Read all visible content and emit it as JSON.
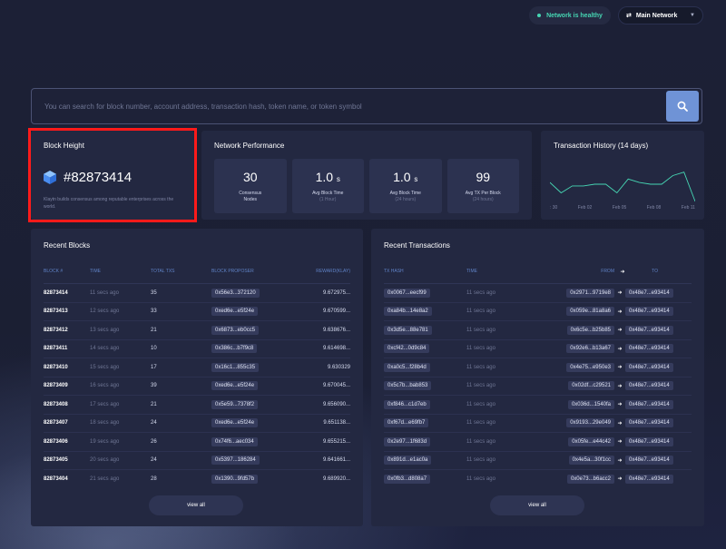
{
  "header": {
    "status": "Network is healthy",
    "network": "Main Network",
    "network_icon": "network-icon",
    "caret_icon": "chevron-down-icon",
    "accent": "#46d6b3"
  },
  "search": {
    "placeholder": "You can search for block number, account address, transaction hash, token name, or token symbol",
    "value": "",
    "icon": "search-icon",
    "button_color": "#6f93d6"
  },
  "block_height": {
    "title": "Block Height",
    "number": "#82873414",
    "description": "Klaytn builds consensus among reputable enterprises across the world.",
    "icon": "cube-icon"
  },
  "network_performance": {
    "title": "Network Performance",
    "stats": [
      {
        "value": "30",
        "unit": "",
        "label": "Consensus Nodes",
        "sub": ""
      },
      {
        "value": "1.0",
        "unit": "s",
        "label": "Avg Block Time",
        "sub": "(1 Hour)"
      },
      {
        "value": "1.0",
        "unit": "s",
        "label": "Avg Block Time",
        "sub": "(24 hours)"
      },
      {
        "value": "99",
        "unit": "",
        "label": "Avg TX Per Block",
        "sub": "(24 hours)"
      }
    ]
  },
  "tx_history": {
    "title": "Transaction History (14 days)",
    "axis": [
      ": 30",
      "Feb 02",
      "Feb 05",
      "Feb 08",
      "Feb 11"
    ],
    "series": [
      0.55,
      0.25,
      0.45,
      0.45,
      0.5,
      0.5,
      0.25,
      0.65,
      0.55,
      0.5,
      0.5,
      0.75,
      0.85,
      0.0
    ],
    "line_color": "#46d6b3"
  },
  "recent_blocks": {
    "title": "Recent Blocks",
    "columns": [
      "BLOCK #",
      "TIME",
      "TOTAL TXS",
      "BLOCK PROPOSER",
      "REWARD(KLAY)"
    ],
    "rows": [
      {
        "block": "82873414",
        "time": "11 secs ago",
        "txs": "35",
        "proposer": "0x56e3...372120",
        "reward": "9.672975..."
      },
      {
        "block": "82873413",
        "time": "12 secs ago",
        "txs": "33",
        "proposer": "0xed6e...e5f24e",
        "reward": "9.670599..."
      },
      {
        "block": "82873412",
        "time": "13 secs ago",
        "txs": "21",
        "proposer": "0x6873...eb0cc5",
        "reward": "9.638676..."
      },
      {
        "block": "82873411",
        "time": "14 secs ago",
        "txs": "10",
        "proposer": "0x386c...b7f9c8",
        "reward": "9.614698..."
      },
      {
        "block": "82873410",
        "time": "15 secs ago",
        "txs": "17",
        "proposer": "0x16c1...855c35",
        "reward": "9.630329"
      },
      {
        "block": "82873409",
        "time": "16 secs ago",
        "txs": "39",
        "proposer": "0xed6e...e5f24e",
        "reward": "9.670045..."
      },
      {
        "block": "82873408",
        "time": "17 secs ago",
        "txs": "21",
        "proposer": "0x5e59...7378f2",
        "reward": "9.656090..."
      },
      {
        "block": "82873407",
        "time": "18 secs ago",
        "txs": "24",
        "proposer": "0xed6e...e5f24e",
        "reward": "9.651138..."
      },
      {
        "block": "82873406",
        "time": "19 secs ago",
        "txs": "26",
        "proposer": "0x74f6...aec034",
        "reward": "9.655215..."
      },
      {
        "block": "82873405",
        "time": "20 secs ago",
        "txs": "24",
        "proposer": "0x5397...186284",
        "reward": "9.641661..."
      },
      {
        "block": "82873404",
        "time": "21 secs ago",
        "txs": "28",
        "proposer": "0x1390...9fd57b",
        "reward": "9.689920..."
      }
    ],
    "view_all": "view all"
  },
  "recent_transactions": {
    "title": "Recent Transactions",
    "columns": [
      "TX HASH",
      "TIME",
      "FROM",
      "➜",
      "TO"
    ],
    "rows": [
      {
        "hash": "0x0067...eecf99",
        "time": "11 secs ago",
        "from": "0x2971...9719e8",
        "to": "0x48e7...e93414"
      },
      {
        "hash": "0xa84b...14e8a2",
        "time": "11 secs ago",
        "from": "0x059e...81a8a6",
        "to": "0x48e7...e93414"
      },
      {
        "hash": "0x3d5e...88e781",
        "time": "11 secs ago",
        "from": "0x6c5e...b25b85",
        "to": "0x48e7...e93414"
      },
      {
        "hash": "0xcf42...0d9c84",
        "time": "11 secs ago",
        "from": "0x92e6...b13a67",
        "to": "0x48e7...e93414"
      },
      {
        "hash": "0xa0c5...f28b4d",
        "time": "11 secs ago",
        "from": "0x4e75...e950e3",
        "to": "0x48e7...e93414"
      },
      {
        "hash": "0x5c7b...bab853",
        "time": "11 secs ago",
        "from": "0x02df...c29521",
        "to": "0x48e7...e93414"
      },
      {
        "hash": "0xf846...c1d7eb",
        "time": "11 secs ago",
        "from": "0x036d...1540fa",
        "to": "0x48e7...e93414"
      },
      {
        "hash": "0xf67d...e69fb7",
        "time": "11 secs ago",
        "from": "0x9193...29e049",
        "to": "0x48e7...e93414"
      },
      {
        "hash": "0x2e97...1f683d",
        "time": "11 secs ago",
        "from": "0x05fe...e44c42",
        "to": "0x48e7...e93414"
      },
      {
        "hash": "0x891d...e1ac0a",
        "time": "11 secs ago",
        "from": "0x4e5a...30f1cc",
        "to": "0x48e7...e93414"
      },
      {
        "hash": "0x0fb3...d808a7",
        "time": "11 secs ago",
        "from": "0x0e73...b6acc2",
        "to": "0x48e7...e93414"
      }
    ],
    "arrow": "➜",
    "view_all": "view all"
  }
}
